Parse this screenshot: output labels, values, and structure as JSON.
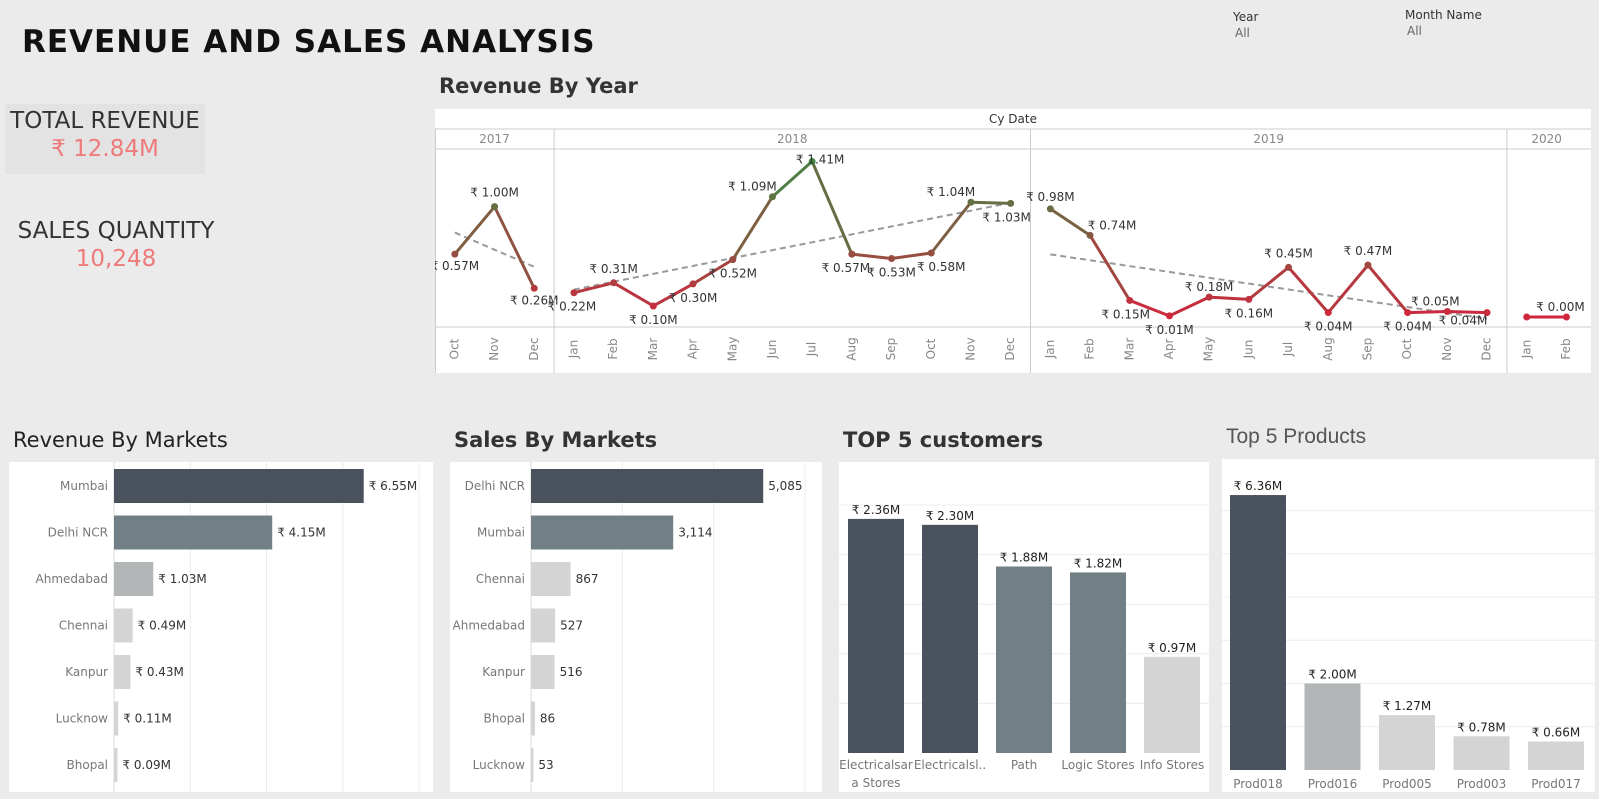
{
  "page": {
    "title": "REVENUE AND SALES ANALYSIS",
    "currency": "₹"
  },
  "filters": [
    {
      "label": "Year",
      "value": "All"
    },
    {
      "label": "Month Name",
      "value": "All"
    }
  ],
  "kpis": {
    "total_revenue": {
      "label": "TOTAL REVENUE",
      "value": "₹ 12.84M"
    },
    "sales_quantity": {
      "label": "SALES QUANTITY",
      "value": "10,248"
    }
  },
  "colors": {
    "dark": "#4a525e",
    "mid": "#727f87",
    "light": "#b3b6b7",
    "lighter": "#d4d4d4",
    "line_high": "#3e8a45",
    "line_low": "#d0263d",
    "trend": "#999999",
    "kpi_value": "#ee7a7a"
  },
  "chart_data": [
    {
      "type": "line",
      "title": "Revenue By Year",
      "header": "Cy Date",
      "unit": "₹ M",
      "trendlines": true,
      "years": [
        {
          "year": "2017",
          "months": [
            "Oct",
            "Nov",
            "Dec"
          ],
          "values": [
            0.57,
            1.0,
            0.26
          ],
          "labels": [
            "₹ 0.57M",
            "₹ 1.00M",
            "₹ 0.26M"
          ]
        },
        {
          "year": "2018",
          "months": [
            "Jan",
            "Feb",
            "Mar",
            "Apr",
            "May",
            "Jun",
            "Jul",
            "Aug",
            "Sep",
            "Oct",
            "Nov",
            "Dec"
          ],
          "values": [
            0.22,
            0.31,
            0.1,
            0.3,
            0.52,
            1.09,
            1.41,
            0.57,
            0.53,
            0.58,
            1.04,
            1.03
          ],
          "labels": [
            "₹ 0.22M",
            "₹ 0.31M",
            "₹ 0.10M",
            "₹ 0.30M",
            "₹ 0.52M",
            "₹ 1.09M",
            "₹ 1.41M",
            "₹ 0.57M",
            "₹ 0.53M",
            "₹ 0.58M",
            "₹ 1.04M",
            "₹ 1.03M"
          ]
        },
        {
          "year": "2019",
          "months": [
            "Jan",
            "Feb",
            "Mar",
            "Apr",
            "May",
            "Jun",
            "Jul",
            "Aug",
            "Sep",
            "Oct",
            "Nov",
            "Dec"
          ],
          "values": [
            0.98,
            0.74,
            0.15,
            0.01,
            0.18,
            0.16,
            0.45,
            0.04,
            0.47,
            0.04,
            0.05,
            0.04
          ],
          "labels": [
            "₹ 0.98M",
            "₹ 0.74M",
            "₹ 0.15M",
            "₹ 0.01M",
            "₹ 0.18M",
            "₹ 0.16M",
            "₹ 0.45M",
            "₹ 0.04M",
            "₹ 0.47M",
            "₹ 0.04M",
            "₹ 0.05M",
            "₹ 0.04M"
          ]
        },
        {
          "year": "2020",
          "months": [
            "Jan",
            "Feb"
          ],
          "values": [
            0.0,
            0.0
          ],
          "labels": [
            "",
            "₹ 0.00M"
          ]
        }
      ]
    },
    {
      "type": "bar",
      "orientation": "horizontal",
      "title": "Revenue By Markets",
      "categories": [
        "Mumbai",
        "Delhi NCR",
        "Ahmedabad",
        "Chennai",
        "Kanpur",
        "Lucknow",
        "Bhopal"
      ],
      "values": [
        6.55,
        4.15,
        1.03,
        0.49,
        0.43,
        0.11,
        0.09
      ],
      "labels": [
        "₹ 6.55M",
        "₹ 4.15M",
        "₹ 1.03M",
        "₹ 0.49M",
        "₹ 0.43M",
        "₹ 0.11M",
        "₹ 0.09M"
      ],
      "xlim": [
        0,
        8
      ],
      "grid": true
    },
    {
      "type": "bar",
      "orientation": "horizontal",
      "title": "Sales By Markets",
      "categories": [
        "Delhi NCR",
        "Mumbai",
        "Chennai",
        "Ahmedabad",
        "Kanpur",
        "Bhopal",
        "Lucknow"
      ],
      "values": [
        5085,
        3114,
        867,
        527,
        516,
        86,
        53
      ],
      "labels": [
        "5,085",
        "3,114",
        "867",
        "527",
        "516",
        "86",
        "53"
      ],
      "xlim": [
        0,
        6000
      ],
      "grid": true
    },
    {
      "type": "bar",
      "orientation": "vertical",
      "title": "TOP 5 customers",
      "categories": [
        "Electricalsara Stores",
        "Electricalsl..",
        "Path",
        "Logic Stores",
        "Info Stores"
      ],
      "values": [
        2.36,
        2.3,
        1.88,
        1.82,
        0.97
      ],
      "labels": [
        "₹ 2.36M",
        "₹ 2.30M",
        "₹ 1.88M",
        "₹ 1.82M",
        "₹ 0.97M"
      ],
      "ylim": [
        0,
        2.5
      ],
      "grid": true
    },
    {
      "type": "bar",
      "orientation": "vertical",
      "title": "Top 5 Products",
      "categories": [
        "Prod018",
        "Prod016",
        "Prod005",
        "Prod003",
        "Prod017"
      ],
      "values": [
        6.36,
        2.0,
        1.27,
        0.78,
        0.66
      ],
      "labels": [
        "₹ 6.36M",
        "₹ 2.00M",
        "₹ 1.27M",
        "₹ 0.78M",
        "₹ 0.66M"
      ],
      "ylim": [
        0,
        6.5
      ],
      "grid": true
    }
  ]
}
